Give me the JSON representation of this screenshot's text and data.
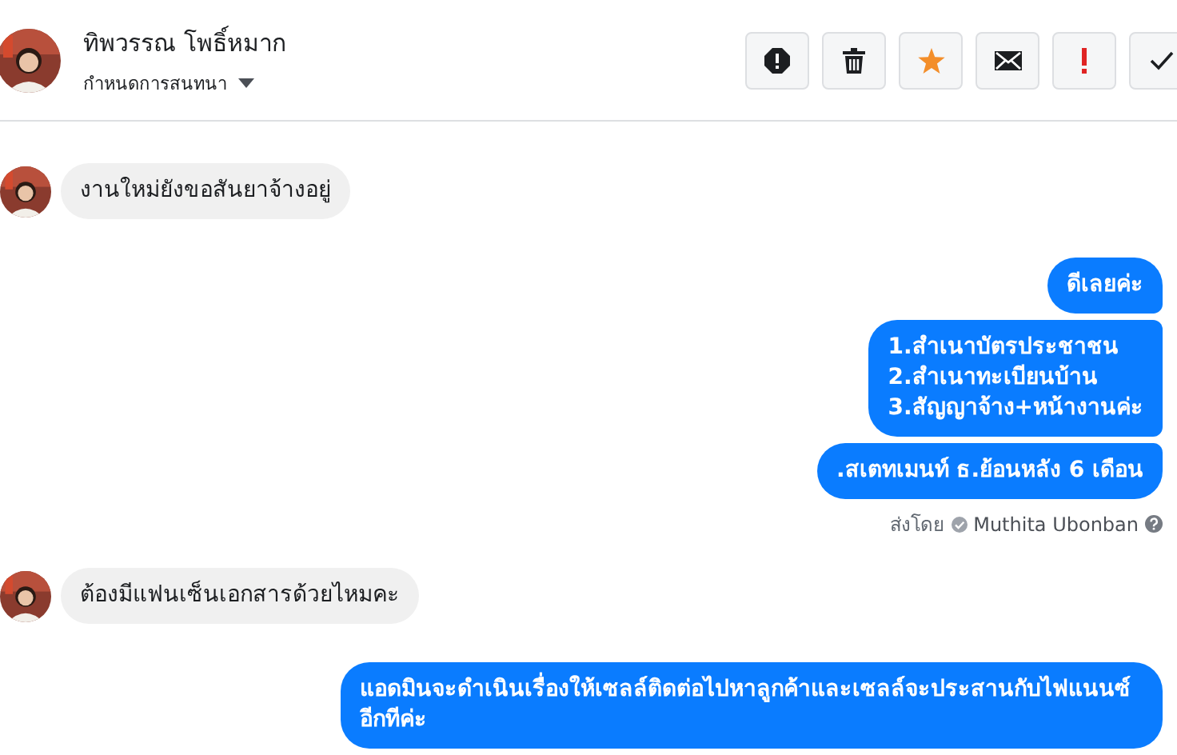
{
  "header": {
    "contact_name": "ทิพวรรณ โพธิ์หมาก",
    "subtitle": "กำหนดการสนทนา",
    "actions": [
      {
        "kind": "report"
      },
      {
        "kind": "delete"
      },
      {
        "kind": "star"
      },
      {
        "kind": "mail"
      },
      {
        "kind": "important"
      },
      {
        "kind": "done"
      }
    ]
  },
  "messages": [
    {
      "kind": "incoming",
      "text": "งานใหม่ยังขอสันยาจ้างอยู่"
    },
    {
      "kind": "outgoing",
      "text": "ดีเลยค่ะ"
    },
    {
      "kind": "outgoing",
      "text": "1.สำเนาบัตรประชาชน\n2.สำเนาทะเบียนบ้าน\n3.สัญญาจ้าง+หน้างานค่ะ"
    },
    {
      "kind": "outgoing",
      "text": ".สเตทเมนท์ ธ.ย้อนหลัง 6 เดือน"
    },
    {
      "kind": "sent_by",
      "label": "ส่งโดย",
      "name": "Muthita Ubonban"
    },
    {
      "kind": "incoming",
      "text": "ต้องมีแฟนเซ็นเอกสารด้วยไหมคะ"
    },
    {
      "kind": "outgoing",
      "text": "แอดมินจะดำเนินเรื่องให้เซลล์ติดต่อไปหาลูกค้าและเซลล์จะประสานกับไฟแนนซ์อีกทีค่ะ"
    }
  ]
}
